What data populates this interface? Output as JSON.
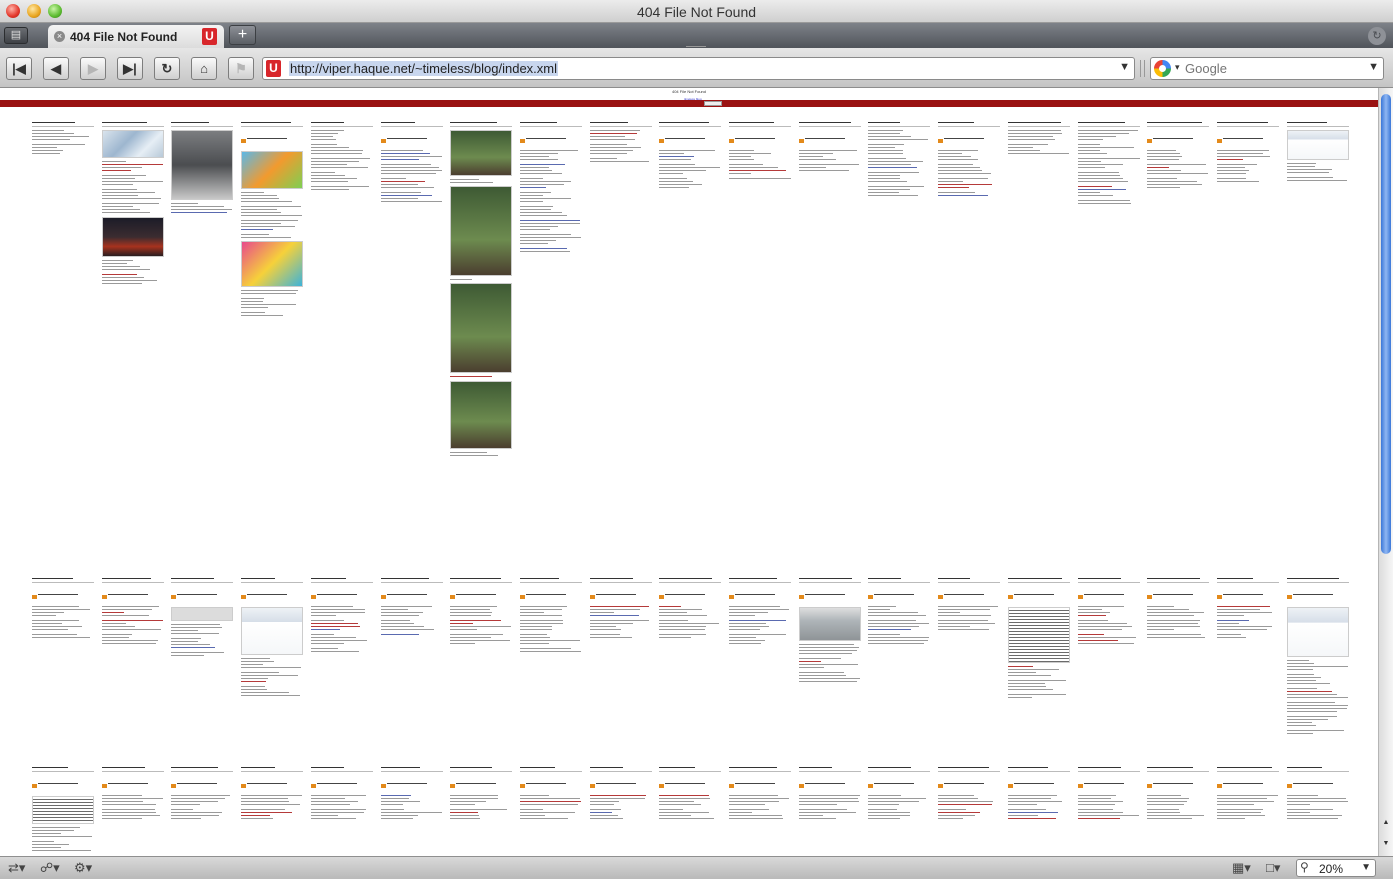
{
  "window": {
    "title": "404 File Not Found"
  },
  "tabs": [
    {
      "label": "404 File Not Found",
      "active": true
    }
  ],
  "toolbar": {
    "url": "http://viper.haque.net/~timeless/blog/index.xml",
    "search_placeholder": "Google",
    "icons": [
      "first-page-icon",
      "back-icon",
      "forward-icon",
      "last-page-icon",
      "reload-icon",
      "home-icon",
      "bookmark-icon"
    ]
  },
  "page": {
    "header_title": "404 File Not Found",
    "header_links": "timeless blog"
  },
  "status": {
    "zoom": "20%"
  },
  "colors": {
    "accent_red": "#9a1212",
    "favicon_red": "#d8262b",
    "scroll_blue": "#3b78d8"
  }
}
